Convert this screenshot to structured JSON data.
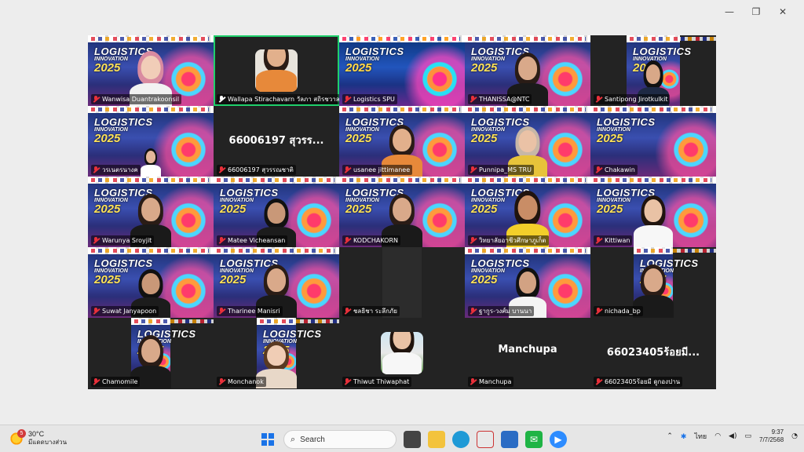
{
  "window_controls": {
    "minimize": "—",
    "restore": "❐",
    "close": "✕"
  },
  "banner": {
    "line1": "LOGISTICS",
    "line2": "INNOVATION",
    "line3": "2025"
  },
  "participants": [
    {
      "name": "Wanwisa Duantrakoonsil",
      "muted": true
    },
    {
      "name": "Wallapa Stirachavarn วัลภา สถิรชวาล",
      "muted": false,
      "active": true
    },
    {
      "name": "Logistics SPU",
      "muted": true
    },
    {
      "name": "THANISSA@NTC",
      "muted": true
    },
    {
      "name": "Santipong Jirotkulkit",
      "muted": true
    },
    {
      "name": "วรเนตรนางค",
      "muted": true
    },
    {
      "name": "66006197 สุวรรณชาติ",
      "muted": true,
      "display_name": "66006197 สุวรร..."
    },
    {
      "name": "usanee jittimanee",
      "muted": true
    },
    {
      "name": "Punnipa_MS TRU",
      "muted": true
    },
    {
      "name": "Chakawin",
      "muted": true
    },
    {
      "name": "Warunya Sroyjit",
      "muted": true
    },
    {
      "name": "Matee Vicheansan",
      "muted": true
    },
    {
      "name": "KODCHAKORN",
      "muted": true
    },
    {
      "name": "วิทยาลัยอาชีวศึกษาภูเก็ต",
      "muted": true
    },
    {
      "name": "Kittiwan",
      "muted": true
    },
    {
      "name": "Suwat Janyapoon",
      "muted": true
    },
    {
      "name": "Tharinee Manisri",
      "muted": true
    },
    {
      "name": "ชลธิชา ระลึกภัย",
      "muted": true
    },
    {
      "name": "ฐากูร-วงศ์ม บานนา",
      "muted": true
    },
    {
      "name": "nichada_bp",
      "muted": true
    },
    {
      "name": "Chamomile",
      "muted": true
    },
    {
      "name": "Monchanok",
      "muted": true
    },
    {
      "name": "Thiwut Thiwaphat",
      "muted": true
    },
    {
      "name": "Manchupa",
      "muted": true,
      "display_name": "Manchupa"
    },
    {
      "name": "66023405ร้อยมี ดูกองปาน",
      "muted": true,
      "display_name": "66023405ร้อยมี..."
    }
  ],
  "taskbar": {
    "weather_temp": "30°C",
    "weather_desc": "มีแดดบางส่วน",
    "weather_badge": "5",
    "search_label": "Search",
    "lang": "ไทย",
    "time": "9:37",
    "date": "7/7/2568"
  },
  "colors": {
    "active_border": "#1fcf6b",
    "mic_muted": "#e8303a"
  }
}
